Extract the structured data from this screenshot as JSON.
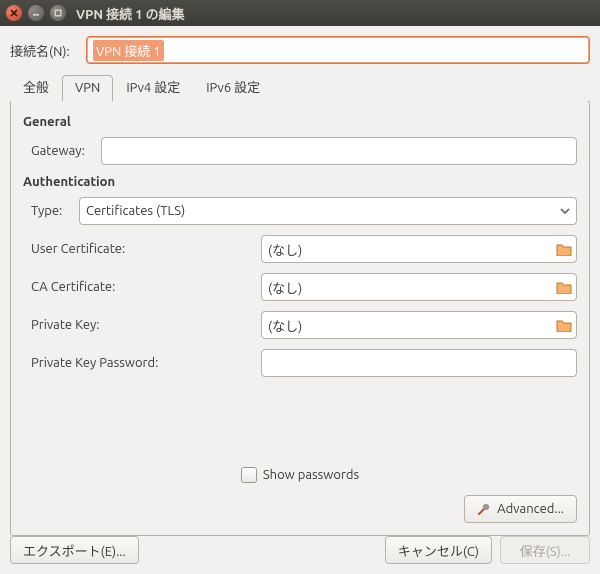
{
  "window": {
    "title": "VPN 接続 1 の編集"
  },
  "connection_name": {
    "label": "接続名(N):",
    "value": "VPN 接続 1"
  },
  "tabs": [
    {
      "id": "general",
      "label": "全般",
      "active": false
    },
    {
      "id": "vpn",
      "label": "VPN",
      "active": true
    },
    {
      "id": "ipv4",
      "label": "IPv4 設定",
      "active": false
    },
    {
      "id": "ipv6",
      "label": "IPv6 設定",
      "active": false
    }
  ],
  "vpn_panel": {
    "general_head": "General",
    "gateway_label": "Gateway:",
    "gateway_value": "",
    "auth_head": "Authentication",
    "type_label": "Type:",
    "type_value": "Certificates (TLS)",
    "user_cert_label": "User Certificate:",
    "user_cert_value": "(なし)",
    "ca_cert_label": "CA Certificate:",
    "ca_cert_value": "(なし)",
    "priv_key_label": "Private Key:",
    "priv_key_value": "(なし)",
    "priv_key_pw_label": "Private Key Password:",
    "priv_key_pw_value": "",
    "show_pw_label": "Show passwords",
    "advanced_label": "Advanced..."
  },
  "footer": {
    "export_label": "エクスポート(E)...",
    "cancel_label": "キャンセル(C)",
    "save_label": "保存(S)..."
  }
}
